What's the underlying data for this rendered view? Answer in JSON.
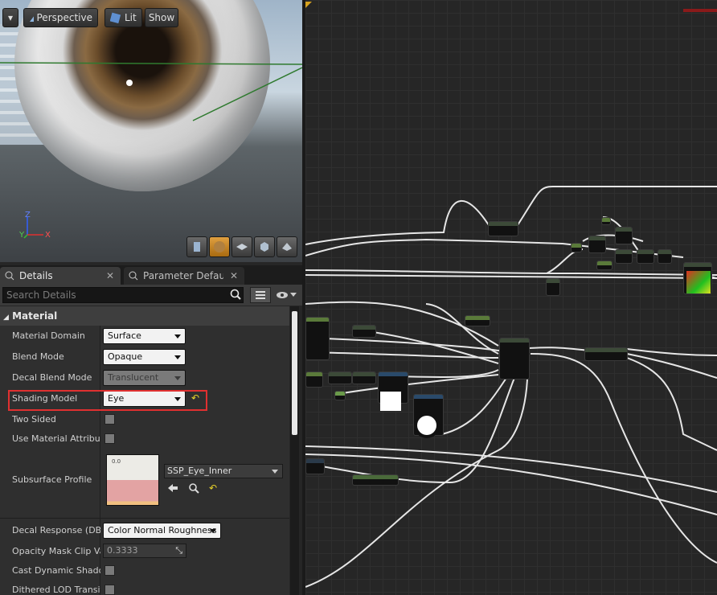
{
  "viewport": {
    "menu_label": "▾",
    "perspective_label": "Perspective",
    "lit_label": "Lit",
    "show_label": "Show",
    "axis": {
      "z": "Z",
      "x": "X",
      "y": "Y"
    },
    "preview_shapes": [
      "cylinder-icon",
      "sphere-icon",
      "plane-icon",
      "cube-icon",
      "custom-mesh-icon"
    ],
    "active_shape": "sphere-icon"
  },
  "tabs": [
    {
      "label": "Details",
      "icon": "details-icon",
      "close": "✕"
    },
    {
      "label": "Parameter Defaults",
      "icon": "details-icon",
      "close": "✕"
    }
  ],
  "search": {
    "placeholder": "Search Details"
  },
  "category": {
    "label": "Material"
  },
  "properties": {
    "material_domain": {
      "label": "Material Domain",
      "value": "Surface"
    },
    "blend_mode": {
      "label": "Blend Mode",
      "value": "Opaque"
    },
    "decal_blend_mode": {
      "label": "Decal Blend Mode",
      "value": "Translucent"
    },
    "shading_model": {
      "label": "Shading Model",
      "value": "Eye",
      "reset": "↶"
    },
    "two_sided": {
      "label": "Two Sided"
    },
    "use_material_attributes": {
      "label": "Use Material Attributes"
    },
    "subsurface_profile": {
      "label": "Subsurface Profile",
      "asset": "SSP_Eye_Inner",
      "thumb_text": "0.0",
      "reset": "↶"
    },
    "decal_response": {
      "label": "Decal Response (DBuffer)",
      "value": "Color Normal Roughness"
    },
    "opacity_mask_clip": {
      "label": "Opacity Mask Clip Value",
      "value": "0.3333"
    },
    "cast_dynamic_shadow": {
      "label": "Cast Dynamic Shadow as Masked"
    },
    "dithered_lod": {
      "label": "Dithered LOD Transition"
    }
  },
  "colors": {
    "accent": "#e0a040",
    "highlight": "#e03030",
    "reset_yellow": "#e8d22a"
  }
}
